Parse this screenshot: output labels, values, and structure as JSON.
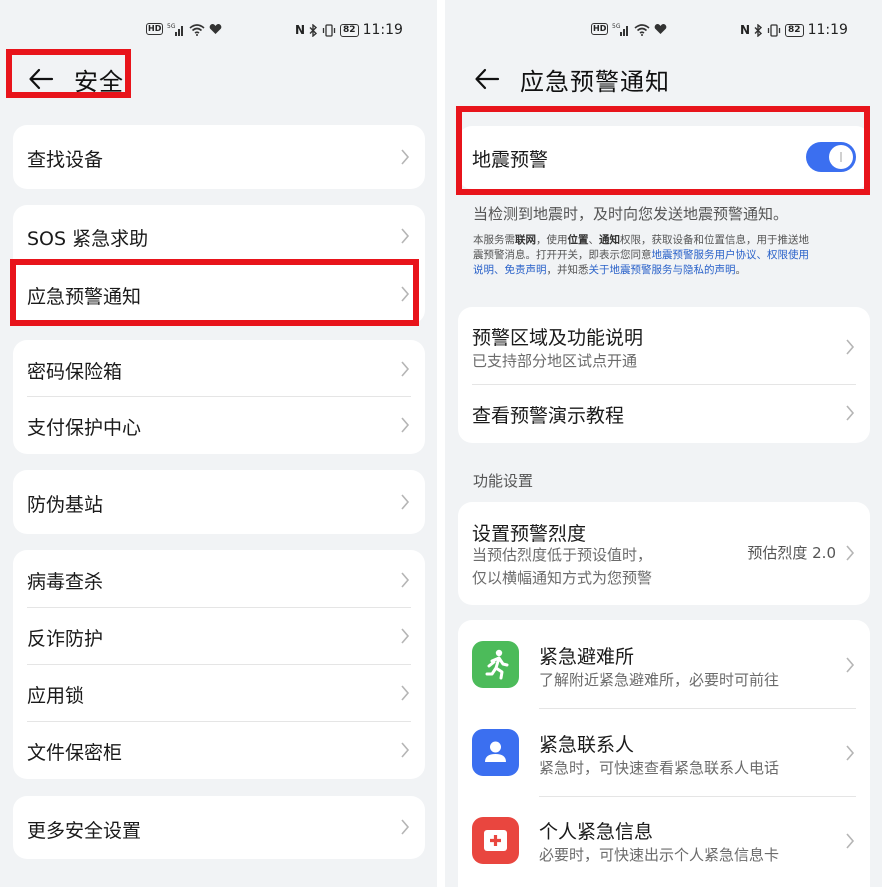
{
  "left": {
    "status": {
      "left_icons": [
        "HD",
        "5G",
        "signal",
        "wifi",
        "heart"
      ],
      "right_icons": [
        "N",
        "bluetooth",
        "vibrate"
      ],
      "battery": "82",
      "time": "11:19"
    },
    "title": "安全",
    "items": {
      "find_device": "查找设备",
      "sos": "SOS 紧急求助",
      "emergency_alert": "应急预警通知",
      "password_vault": "密码保险箱",
      "payment_protection": "支付保护中心",
      "anti_fake_base_station": "防伪基站",
      "virus_scan": "病毒查杀",
      "anti_fraud": "反诈防护",
      "app_lock": "应用锁",
      "file_safe": "文件保密柜",
      "more_security": "更多安全设置"
    }
  },
  "right": {
    "status": {
      "battery": "82",
      "time": "11:19"
    },
    "title": "应急预警通知",
    "earthquake": {
      "label": "地震预警",
      "enabled": true
    },
    "desc": "当检测到地震时，及时向您发送地震预警通知。",
    "notice": {
      "l1_a": "本服务需",
      "l1_b": "联网",
      "l1_c": "，使用",
      "l1_d": "位置",
      "l1_e": "、",
      "l1_f": "通知",
      "l1_g": "权限，获取设备和位置信息，用于推送地",
      "l2_a": "震预警消息。打开开关，即表示您同意",
      "l2_b": "地震预警服务用户协议",
      "l2_c": "、",
      "l2_d": "权限使用",
      "l3_a": "说明",
      "l3_b": "、",
      "l3_c": "免责声明",
      "l3_d": "，并知悉",
      "l3_e": "关于地震预警服务与隐私的声明",
      "l3_f": "。"
    },
    "area": {
      "title": "预警区域及功能说明",
      "sub": "已支持部分地区试点开通"
    },
    "tutorial": "查看预警演示教程",
    "section": "功能设置",
    "intensity": {
      "title": "设置预警烈度",
      "sub1": "当预估烈度低于预设值时，",
      "sub2": "仅以横幅通知方式为您预警",
      "value": "预估烈度 2.0"
    },
    "shelter": {
      "title": "紧急避难所",
      "sub": "了解附近紧急避难所，必要时可前往"
    },
    "contacts": {
      "title": "紧急联系人",
      "sub": "紧急时，可快速查看紧急联系人电话"
    },
    "info": {
      "title": "个人紧急信息",
      "sub": "必要时，可快速出示个人紧急信息卡"
    }
  },
  "colors": {
    "highlight": "#e8141b",
    "toggle": "#3b6ff0",
    "shelter_icon": "#4cbb5a",
    "contacts_icon": "#3b6ff0",
    "info_icon": "#e9463f",
    "link": "#2a62c9"
  }
}
